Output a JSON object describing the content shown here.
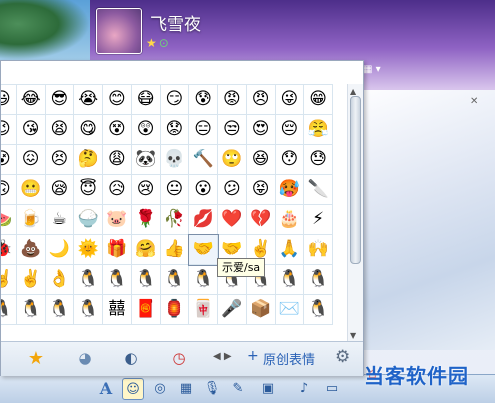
{
  "chat": {
    "nickname": "飞雪夜",
    "toolbar": {
      "font_label": "A"
    }
  },
  "watermark": "当客软件园",
  "emoji_panel": {
    "rows": [
      [
        "😃",
        "😂",
        "😎",
        "😭",
        "😊",
        "😷",
        "😏",
        "😰",
        "😡",
        "😠",
        "😜",
        "😁"
      ],
      [
        "😉",
        "😘",
        "😫",
        "😋",
        "😵",
        "😲",
        "😟",
        "😑",
        "😒",
        "😍",
        "😔",
        "😤"
      ],
      [
        "😵",
        "😖",
        "😣",
        "🤔",
        "😩",
        "🐼",
        "💀",
        "🔨",
        "🙄",
        "😆",
        "😯",
        "😓"
      ],
      [
        "🙃",
        "😬",
        "😪",
        "😇",
        "😥",
        "😢",
        "😐",
        "😮",
        "😕",
        "😝",
        "🥵",
        "🔪"
      ],
      [
        "🍉",
        "🍺",
        "☕",
        "🍚",
        "🐷",
        "🌹",
        "🥀",
        "💋",
        "❤️",
        "💔",
        "🎂",
        "⚡"
      ],
      [
        "🐞",
        "💩",
        "🌙",
        "🌞",
        "🎁",
        "🤗",
        "👍",
        "🤝",
        "🤝",
        "✌️",
        "🙏",
        "🙌"
      ],
      [
        "🤘",
        "✌️",
        "👌",
        "🐧",
        "🐧",
        "🐧",
        "🐧",
        "🐧",
        "🐧",
        "🐧",
        "🐧",
        "🐧"
      ],
      [
        "🐧",
        "🐧",
        "🐧",
        "🐧",
        "囍",
        "🧧",
        "🏮",
        "🀄",
        "🎤",
        "📦",
        "✉️",
        "🐧"
      ]
    ],
    "hover_cell": {
      "row": 5,
      "col": 7
    },
    "tooltip": "示爱/sa",
    "add_custom_label": "原创表情",
    "tabs": [
      "star-icon",
      "face-icon",
      "emoticon-icon",
      "clock-icon"
    ]
  },
  "icons": {
    "star": "★",
    "add": "+",
    "gear": "⚙",
    "left_right": "◀ ▶"
  }
}
